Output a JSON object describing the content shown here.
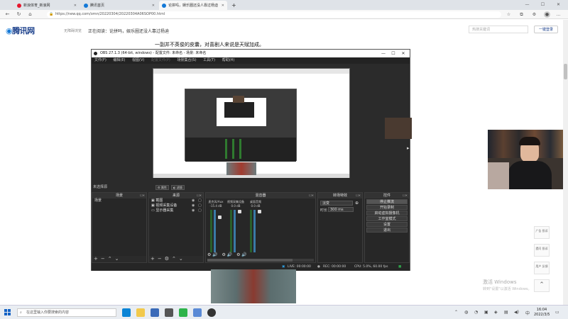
{
  "browser": {
    "tabs": [
      {
        "label": "新浪体育_新浪网",
        "color": "#e6162d"
      },
      {
        "label": "腾讯首页",
        "color": "#1479d7"
      },
      {
        "label": "论拼吗，娱乐圈还没人靠过杨迪",
        "color": "#1479d7"
      }
    ],
    "url": "https://new.qq.com/omn/20220304/20220304A06SOP00.html",
    "new_tab": "+"
  },
  "page": {
    "logo": "腾讯网",
    "logo_sub": "无障碍浏览",
    "reading_prefix": "正在阅读：",
    "reading_title": "论拼吗，娱乐圈还没人靠过杨迪",
    "search_placeholder": "热搜关键词",
    "login": "一键登录",
    "article_line": "一副并不英俊的皮囊，对喜剧人来说是天赋加成。",
    "float_items": [
      "广告 投诉",
      "提问 投诉",
      "用户 反馈"
    ],
    "watermark_title": "激活 Windows",
    "watermark_sub": "转到\"设置\"以激活 Windows。"
  },
  "obs": {
    "title": "OBS 27.1.3 (64-bit, windows) - 配置文件: 未命名 - 场景: 未命名",
    "menu": [
      "文件(F)",
      "编辑(E)",
      "视图(V)",
      "配置文件(P)",
      "场景集合(S)",
      "工具(T)",
      "帮助(H)"
    ],
    "scene_bar_label": "未选择源",
    "scene_bar_btn1": "属性",
    "scene_bar_btn2": "滤镜",
    "docks": {
      "scenes": {
        "title": "场景",
        "items": [
          "场景"
        ]
      },
      "sources": {
        "title": "来源",
        "items": [
          "截图",
          "视频采集设备",
          "显示器采集"
        ]
      },
      "mixer": {
        "title": "混音器",
        "channels": [
          {
            "name": "麦克风/Aux",
            "db": "-15.4 dB"
          },
          {
            "name": "视频采集设备",
            "db": "0.0 dB"
          },
          {
            "name": "桌面音频",
            "db": "0.0 dB"
          }
        ]
      },
      "transitions": {
        "title": "转场特效",
        "type": "淡变",
        "duration_label": "时长",
        "duration": "300 ms"
      },
      "controls": {
        "title": "控件",
        "buttons": [
          "停止推流",
          "开始录制",
          "启动虚拟摄像机",
          "工作室模式",
          "设置",
          "退出"
        ]
      }
    },
    "status": {
      "live": "LIVE: 00:00:00",
      "rec": "REC: 00:00:00",
      "cpu": "CPU: 5.0%, 60.00 fps"
    }
  },
  "taskbar": {
    "search": "在这里输入你要搜索的内容",
    "time": "16:04",
    "date": "2022/3/5"
  }
}
